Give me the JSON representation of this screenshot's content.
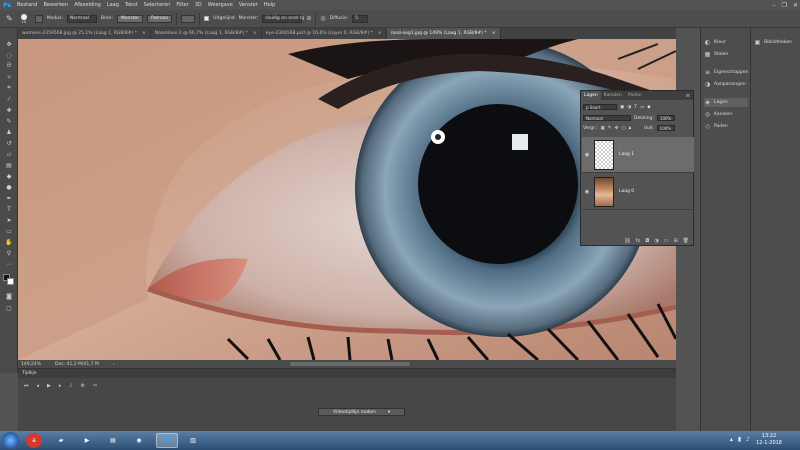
{
  "app": {
    "logo": "Ps"
  },
  "menubar": {
    "items": [
      "Bestand",
      "Bewerken",
      "Afbeelding",
      "Laag",
      "Tekst",
      "Selecteren",
      "Filter",
      "3D",
      "Weergave",
      "Venster",
      "Help"
    ],
    "window_controls": [
      "–",
      "❐",
      "✕"
    ]
  },
  "options": {
    "brush_size": "10",
    "modus_label": "Modus:",
    "modus_value": "Normaal",
    "bron_label": "Bron:",
    "bron_button1": "Monster",
    "bron_button2": "Patroon",
    "uitgelijnd": "Uitgelijnd",
    "monster_label": "Monster:",
    "monster_value": "Huidig en ondr lg",
    "diffusie_label": "Diffusie:",
    "diffusie_value": "5"
  },
  "tabs": [
    {
      "label": "womens-2359568.jpg @ 25,1% (Laag 1, RGB/8#) *"
    },
    {
      "label": "Naamloos-1 @ 66,7% (Laag 1, RGB/8#) *"
    },
    {
      "label": "eye-2366568.psd @ 16,6% (Layer 0, RGB/8#) *"
    },
    {
      "label": "rood-oog1.jpg @ 149% (Laag 1, RGB/8#) *"
    }
  ],
  "tab_close": "×",
  "status": {
    "zoom": "149,24%",
    "doc": "Doc: 41,2 M/41,7 M",
    "arrow": "›"
  },
  "timeline": {
    "title": "Tijdlijn",
    "create_button": "Videotijdlijn maken",
    "dropdown_arrow": "▾"
  },
  "dock1": [
    {
      "label": "Kleur",
      "icon": "palette-icon"
    },
    {
      "label": "Stalen",
      "icon": "swatches-icon"
    },
    {
      "label": "Eigenschappen",
      "icon": "properties-icon"
    },
    {
      "label": "Aanpassingen",
      "icon": "adjustments-icon"
    },
    {
      "label": "Lagen",
      "icon": "layers-icon"
    },
    {
      "label": "Kanalen",
      "icon": "channels-icon"
    },
    {
      "label": "Paden",
      "icon": "paths-icon"
    }
  ],
  "dock2": [
    {
      "label": "Bibliotheken",
      "icon": "libraries-icon"
    }
  ],
  "layers_panel": {
    "tabs": [
      "Lagen",
      "Kanalen",
      "Paden"
    ],
    "filter_label": "ρ Soort",
    "blend_mode": "Normaal",
    "opacity_label": "Dekking:",
    "opacity_value": "100%",
    "lock_label": "Vergr.:",
    "fill_label": "Vull:",
    "fill_value": "100%",
    "layers": [
      {
        "name": "Laag 1",
        "selected": true
      },
      {
        "name": "Laag 0",
        "selected": false
      }
    ]
  },
  "taskbar": {
    "time": "13:22",
    "date": "12-1-2018"
  },
  "colors": {
    "accent": "#31a8ff",
    "panel": "#535353",
    "iris": "#5f7487"
  }
}
